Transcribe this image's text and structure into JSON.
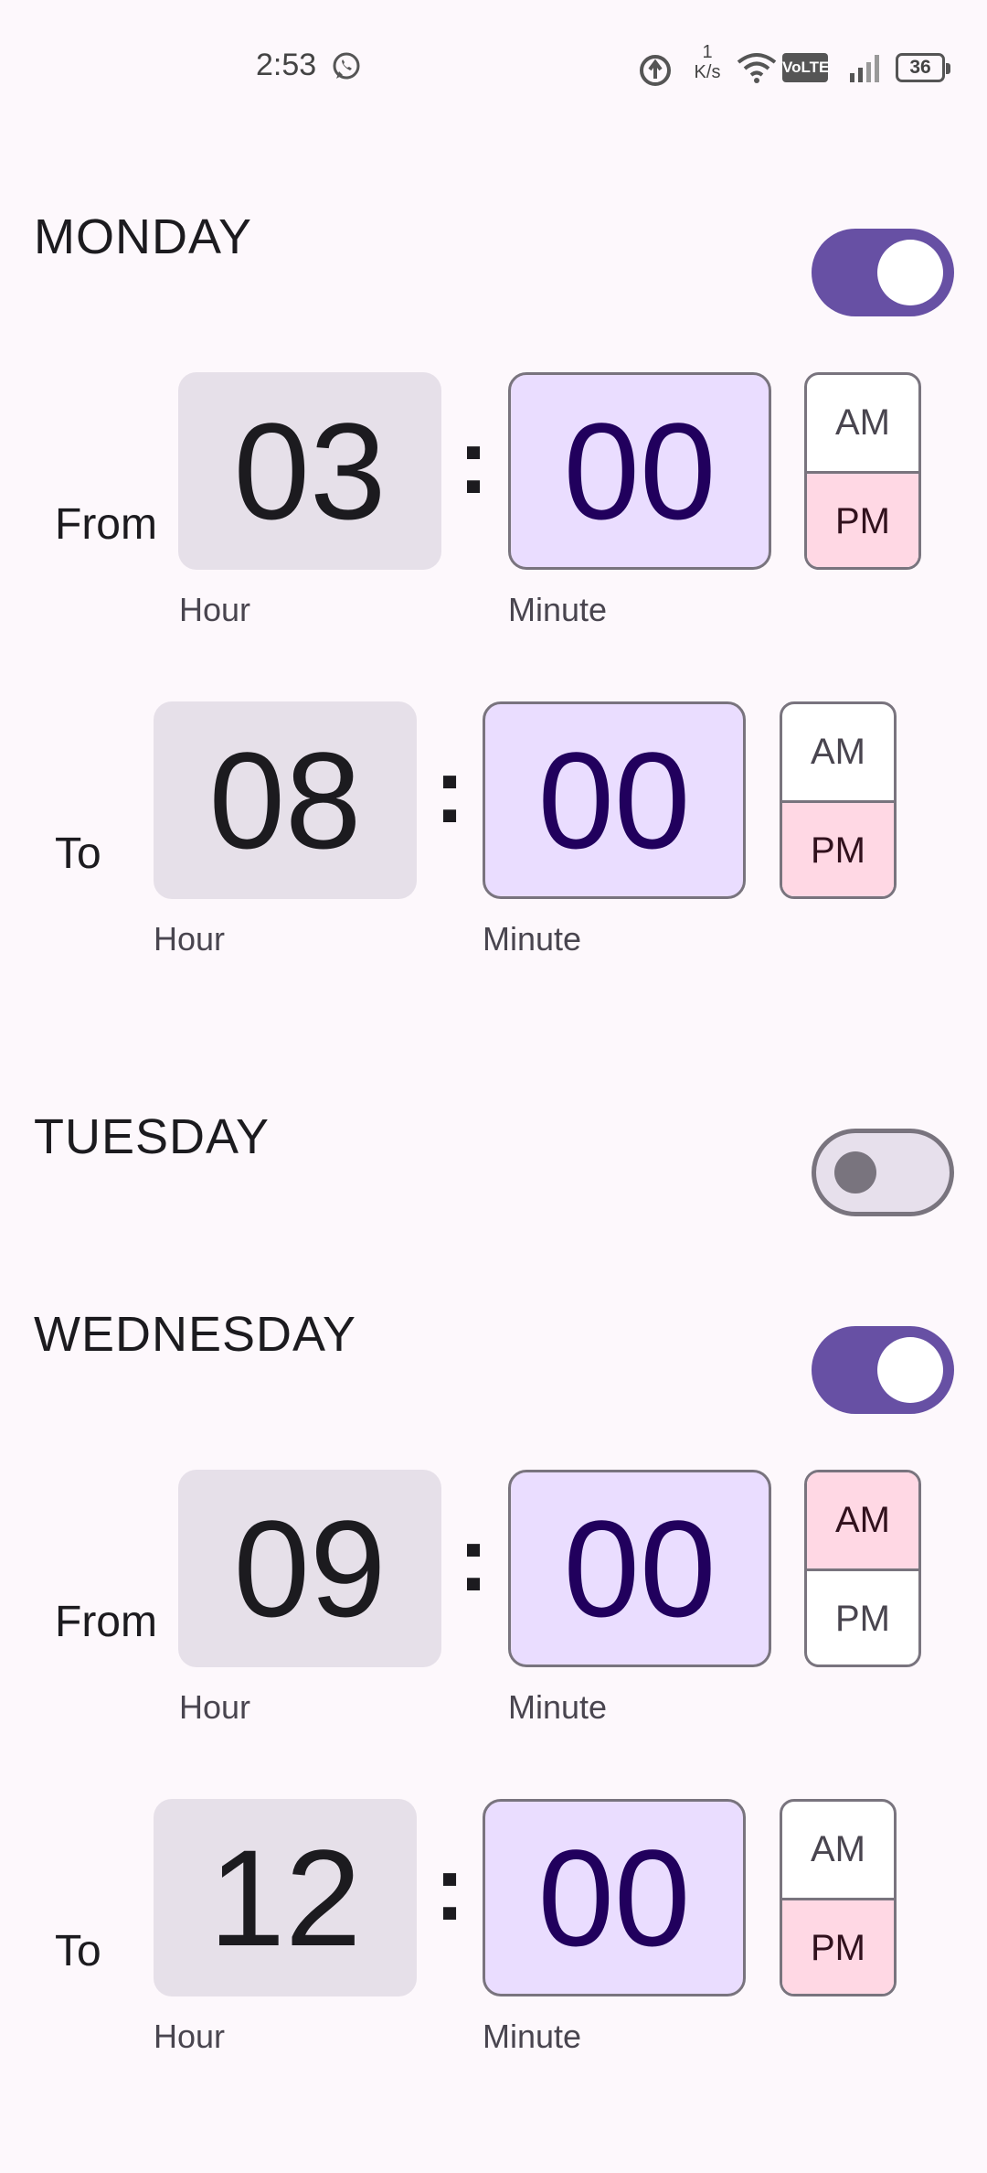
{
  "status_bar": {
    "time": "2:53",
    "speed_value": "1",
    "speed_unit": "K/s",
    "volte": "VoLTE",
    "battery": "36",
    "icons": [
      "whatsapp-icon",
      "data-saver-icon",
      "wifi-icon",
      "signal-icon",
      "battery-icon"
    ]
  },
  "labels": {
    "from": "From",
    "to": "To",
    "hour": "Hour",
    "minute": "Minute",
    "am": "AM",
    "pm": "PM",
    "colon": ":"
  },
  "days": {
    "monday": {
      "name": "MONDAY",
      "enabled": true,
      "from": {
        "hour": "03",
        "minute": "00",
        "period": "PM"
      },
      "to": {
        "hour": "08",
        "minute": "00",
        "period": "PM"
      }
    },
    "tuesday": {
      "name": "TUESDAY",
      "enabled": false
    },
    "wednesday": {
      "name": "WEDNESDAY",
      "enabled": true,
      "from": {
        "hour": "09",
        "minute": "00",
        "period": "AM"
      },
      "to": {
        "hour": "12",
        "minute": "00",
        "period": "PM"
      }
    }
  },
  "colors": {
    "switch_on": "#6750a4",
    "minute_bg": "#eaddff",
    "hour_bg": "#e6e0e9",
    "period_selected": "#ffd8e4"
  }
}
